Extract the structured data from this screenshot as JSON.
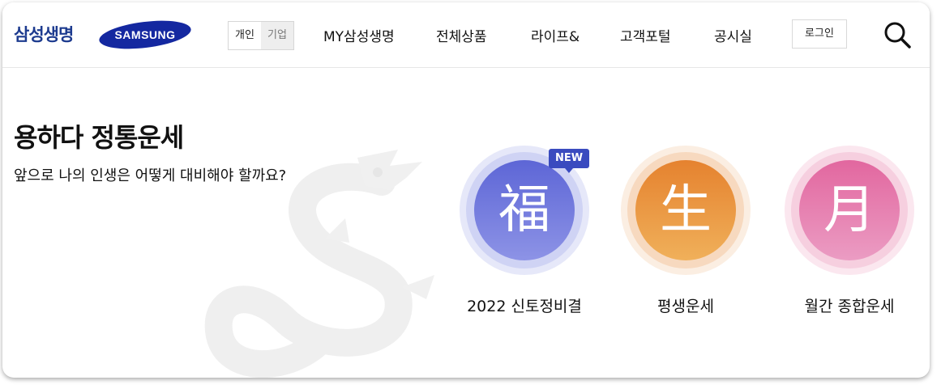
{
  "header": {
    "brand_kr": "삼성생명",
    "brand_en": "SAMSUNG",
    "segments": [
      {
        "label": "개인",
        "active": true
      },
      {
        "label": "기업",
        "active": false
      }
    ],
    "nav": [
      "MY삼성생명",
      "전체상품",
      "라이프&",
      "고객포털",
      "공시실"
    ],
    "login_label": "로그인",
    "search_icon": "search-icon"
  },
  "main": {
    "title": "용하다 정통운세",
    "subtitle": "앞으로 나의 인생은 어떻게 대비해야 할까요?",
    "cards": [
      {
        "glyph": "福",
        "label": "2022 신토정비결",
        "badge": "NEW",
        "color": "#6b72d9"
      },
      {
        "glyph": "生",
        "label": "평생운세",
        "badge": "",
        "color": "#ea8c3c"
      },
      {
        "glyph": "月",
        "label": "월간 종합운세",
        "badge": "",
        "color": "#e46aa0"
      }
    ]
  }
}
